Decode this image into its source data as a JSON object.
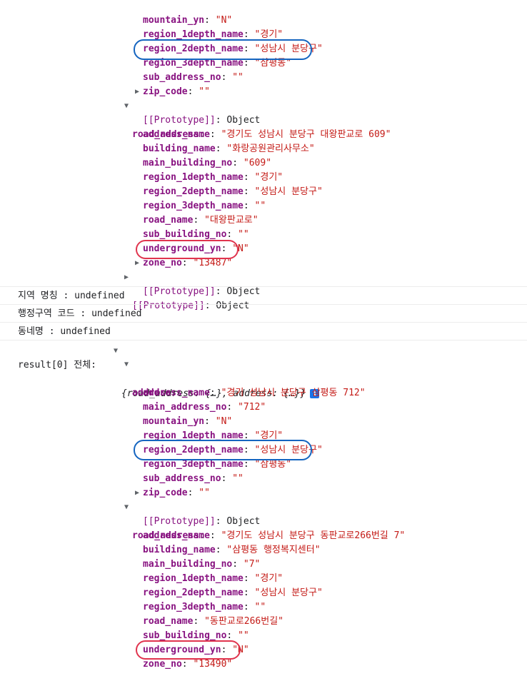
{
  "first_object": {
    "address_rows": [
      {
        "key": "mountain_yn",
        "val": "\"N\""
      },
      {
        "key": "region_1depth_name",
        "val": "\"경기\""
      },
      {
        "key": "region_2depth_name",
        "val": "\"성남시 분당구\""
      },
      {
        "key": "region_3depth_name",
        "val": "\"삼평동\""
      },
      {
        "key": "sub_address_no",
        "val": "\"\""
      },
      {
        "key": "zip_code",
        "val": "\"\""
      }
    ],
    "prototype_1": "[[Prototype]]",
    "prototype_1_val": "Object",
    "road_address_label": "road_address",
    "road_address_rows": [
      {
        "key": "address_name",
        "val": "\"경기도 성남시 분당구 대왕판교로 609\""
      },
      {
        "key": "building_name",
        "val": "\"화랑공원관리사무소\""
      },
      {
        "key": "main_building_no",
        "val": "\"609\""
      },
      {
        "key": "region_1depth_name",
        "val": "\"경기\""
      },
      {
        "key": "region_2depth_name",
        "val": "\"성남시 분당구\""
      },
      {
        "key": "region_3depth_name",
        "val": "\"\""
      },
      {
        "key": "road_name",
        "val": "\"대왕판교로\""
      },
      {
        "key": "sub_building_no",
        "val": "\"\""
      },
      {
        "key": "underground_yn",
        "val": "\"N\""
      },
      {
        "key": "zone_no",
        "val": "\"13487\""
      }
    ],
    "prototype_2": "[[Prototype]]",
    "prototype_2_val": "Object",
    "prototype_3": "[[Prototype]]",
    "prototype_3_val": "Object"
  },
  "messages": [
    "지역 명칭 : undefined",
    "행정구역 코드 : undefined",
    "동네명 : undefined"
  ],
  "second_log": {
    "label": "result[0] 전체: ",
    "summary": "{road_address: {…}, address: {…}}",
    "info_icon": "i",
    "address_label": "address",
    "address_rows": [
      {
        "key": "address_name",
        "val": "\"경기 성남시 분당구 삼평동 712\""
      },
      {
        "key": "main_address_no",
        "val": "\"712\""
      },
      {
        "key": "mountain_yn",
        "val": "\"N\""
      },
      {
        "key": "region_1depth_name",
        "val": "\"경기\""
      },
      {
        "key": "region_2depth_name",
        "val": "\"성남시 분당구\""
      },
      {
        "key": "region_3depth_name",
        "val": "\"삼평동\""
      },
      {
        "key": "sub_address_no",
        "val": "\"\""
      },
      {
        "key": "zip_code",
        "val": "\"\""
      }
    ],
    "prototype_1": "[[Prototype]]",
    "prototype_1_val": "Object",
    "road_address_label": "road_address",
    "road_address_rows": [
      {
        "key": "address_name",
        "val": "\"경기도 성남시 분당구 동판교로266번길 7\""
      },
      {
        "key": "building_name",
        "val": "\"삼평동 행정복지센터\""
      },
      {
        "key": "main_building_no",
        "val": "\"7\""
      },
      {
        "key": "region_1depth_name",
        "val": "\"경기\""
      },
      {
        "key": "region_2depth_name",
        "val": "\"성남시 분당구\""
      },
      {
        "key": "region_3depth_name",
        "val": "\"\""
      },
      {
        "key": "road_name",
        "val": "\"동판교로266번길\""
      },
      {
        "key": "sub_building_no",
        "val": "\"\""
      },
      {
        "key": "underground_yn",
        "val": "\"N\""
      },
      {
        "key": "zone_no",
        "val": "\"13490\""
      }
    ]
  },
  "colors": {
    "key": "#881280",
    "string": "#c41a16",
    "highlight_blue": "#1565c0",
    "highlight_red": "#e0344e",
    "info_badge": "#1a73e8"
  },
  "icons": [
    "expand-triangle-icon",
    "collapse-triangle-icon",
    "info-icon"
  ]
}
